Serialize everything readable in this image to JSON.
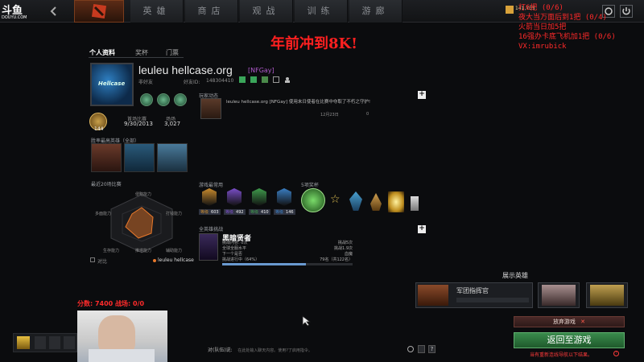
{
  "nav": {
    "items": [
      "英雄",
      "商店",
      "观战",
      "训练",
      "游廊"
    ],
    "douyu_logo": "斗鱼",
    "douyu_domain": "DOUYU.COM",
    "gold": "141,735"
  },
  "overlay": {
    "lines": [
      "打6把 (0/6)",
      "夜大当万面后到1把 (0/4)",
      "火箭当日加5把",
      "16强办卡底飞机加1把 (0/6)",
      "VX:imrubick"
    ],
    "banner": "年前冲到8K!",
    "score": "分数: 7400 战场: 0/0"
  },
  "profile": {
    "tabs": [
      "个人资料",
      "奖杯",
      "门票"
    ],
    "name": "leuleu hellcase.org",
    "tag": "[NFGay]",
    "avatar_text": "Hellcase",
    "status": "非好友",
    "friend_id_label": "好友ID:",
    "friend_id": "148304410",
    "level": "144",
    "first_match_label": "首场比赛",
    "first_match": "9/30/2013",
    "matches_label": "场场",
    "matches": "3,027",
    "best_heroes_label": "胜率最高英雄（全部）",
    "radar_title": "最近20场比赛",
    "radar_labels": [
      "侵略能力",
      "打钱能力",
      "辅助能力",
      "推塔能力",
      "生存能力",
      "多面能力"
    ],
    "legend_compare": "对比",
    "legend_player": "leuleu hellcase"
  },
  "activity": {
    "title": "玩家动态",
    "entry": "leuleu hellcase.org [NFGay] 使用末日使者在比赛中夺取了不朽之守护!",
    "date": "12月23日",
    "likes": "0"
  },
  "guilds": {
    "title": "游戏最常用",
    "ranks": [
      {
        "label": "等级",
        "value": "603",
        "color": "#c98b2e"
      },
      {
        "label": "等级",
        "value": "492",
        "color": "#7a4ec8"
      },
      {
        "label": "等级",
        "value": "410",
        "color": "#3f9b4c"
      },
      {
        "label": "等级",
        "value": "146",
        "color": "#3a7ec3"
      }
    ],
    "trophies_label": "5项奖杯"
  },
  "battle": {
    "title": "全英雄挑战",
    "hero_name": "黑暗贤者",
    "rows": [
      {
        "label": "挑战内容: 0次",
        "value": "挑战5次"
      },
      {
        "label": "全球全服水平",
        "value": "挑战1.9次"
      },
      {
        "label": "下一个是否",
        "value": "血魔"
      },
      {
        "label": "挑战进行中（64%）",
        "value": "79名（共122名）"
      }
    ],
    "progress": 0.64
  },
  "showcase": {
    "title": "展示英雄",
    "card_label": "军团指挥官"
  },
  "actions": {
    "abandon": "放弃游戏",
    "return": "返回至游戏",
    "warning": "当有重新连线导航以下结果。"
  },
  "chat": {
    "label": "对(队伍)说:",
    "hint": "在此处输入聊天内容。使用?了启用指令。"
  }
}
